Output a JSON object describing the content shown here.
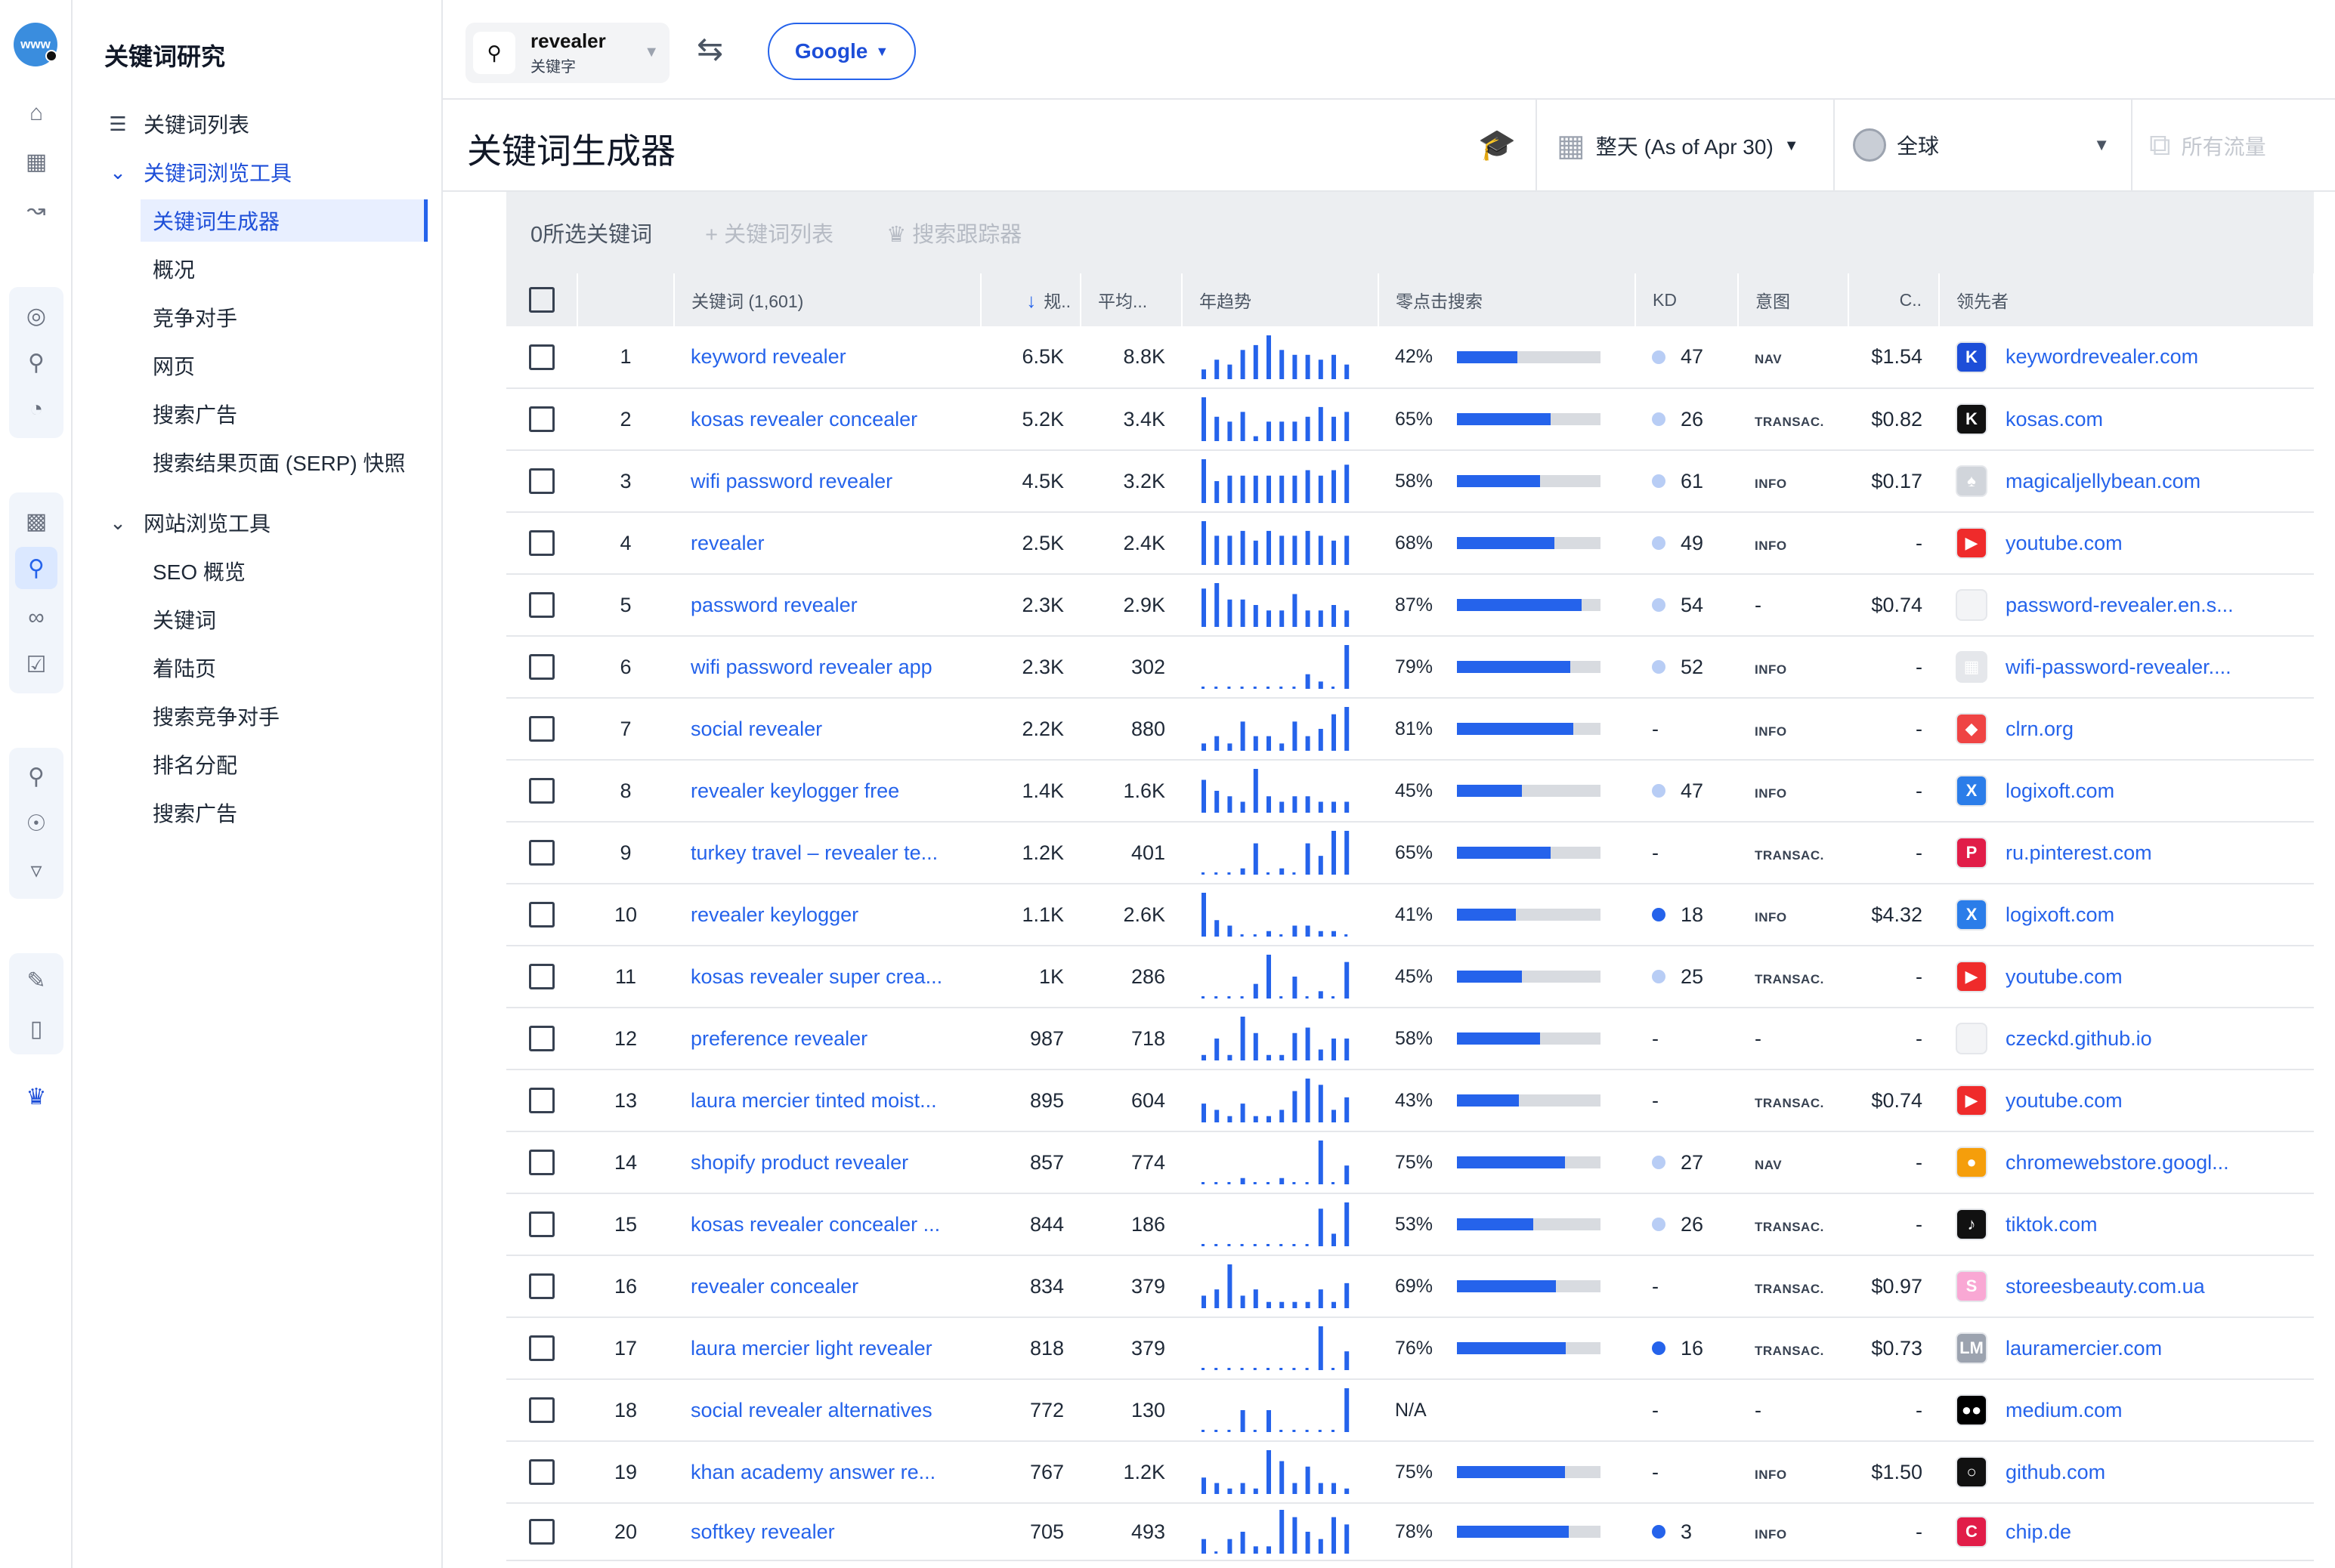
{
  "app": {
    "logo_text": "www",
    "section_title": "关键词研究"
  },
  "sidebar": {
    "items": [
      {
        "label": "关键词列表",
        "level": 1,
        "icon": "list-icon"
      },
      {
        "label": "关键词浏览工具",
        "level": 1,
        "icon": "chevron-down-icon",
        "expanded": true,
        "blue": true
      },
      {
        "label": "关键词生成器",
        "level": 2,
        "selected": true
      },
      {
        "label": "概况",
        "level": 2
      },
      {
        "label": "竞争对手",
        "level": 2
      },
      {
        "label": "网页",
        "level": 2
      },
      {
        "label": "搜索广告",
        "level": 2
      },
      {
        "label": "搜索结果页面 (SERP) 快照",
        "level": 2
      },
      {
        "label": "网站浏览工具",
        "level": 1,
        "icon": "chevron-down-icon",
        "expanded": true
      },
      {
        "label": "SEO 概览",
        "level": 2
      },
      {
        "label": "关键词",
        "level": 2
      },
      {
        "label": "着陆页",
        "level": 2
      },
      {
        "label": "搜索竞争对手",
        "level": 2
      },
      {
        "label": "排名分配",
        "level": 2
      },
      {
        "label": "搜索广告",
        "level": 2
      }
    ]
  },
  "topbar": {
    "search_value": "revealer",
    "search_type": "关键字",
    "engine": "Google"
  },
  "header": {
    "title": "关键词生成器",
    "date": "整天 (As of Apr 30)",
    "geo": "全球",
    "traffic": "所有流量"
  },
  "actions": {
    "selected_count": "0所选关键词",
    "add_list": "+ 关键词列表",
    "tracker": "搜索跟踪器"
  },
  "table": {
    "headers": {
      "keyword": "关键词 (1,601)",
      "volume": "规..",
      "avg": "平均...",
      "trend": "年趋势",
      "zero_click": "零点击搜索",
      "kd": "KD",
      "intent": "意图",
      "cpc": "C..",
      "leader": "领先者"
    },
    "rows": [
      {
        "n": "1",
        "kw": "keyword revealer",
        "vol": "6.5K",
        "avg": "8.8K",
        "zc": "42%",
        "zcv": 42,
        "kd": "47",
        "kdHi": false,
        "intent": "NAV",
        "cpc": "$1.54",
        "leader": "keywordrevealer.com",
        "fav": "K",
        "favBg": "#1d4ed8",
        "trend": [
          2,
          4,
          3,
          6,
          7,
          9,
          6,
          5,
          5,
          4,
          5,
          3
        ]
      },
      {
        "n": "2",
        "kw": "kosas revealer concealer",
        "vol": "5.2K",
        "avg": "3.4K",
        "zc": "65%",
        "zcv": 65,
        "kd": "26",
        "kdHi": false,
        "intent": "TRANSAC.",
        "cpc": "$0.82",
        "leader": "kosas.com",
        "fav": "K",
        "favBg": "#111111",
        "trend": [
          9,
          5,
          4,
          6,
          1,
          4,
          4,
          4,
          5,
          7,
          5,
          6
        ]
      },
      {
        "n": "3",
        "kw": "wifi password revealer",
        "vol": "4.5K",
        "avg": "3.2K",
        "zc": "58%",
        "zcv": 58,
        "kd": "61",
        "kdHi": false,
        "intent": "INFO",
        "cpc": "$0.17",
        "leader": "magicaljellybean.com",
        "fav": "♠",
        "favBg": "#d1d5db",
        "trend": [
          8,
          4,
          5,
          5,
          5,
          5,
          5,
          5,
          6,
          5,
          6,
          7
        ]
      },
      {
        "n": "4",
        "kw": "revealer",
        "vol": "2.5K",
        "avg": "2.4K",
        "zc": "68%",
        "zcv": 68,
        "kd": "49",
        "kdHi": false,
        "intent": "INFO",
        "cpc": "-",
        "leader": "youtube.com",
        "fav": "▶",
        "favBg": "#ef2b2b",
        "trend": [
          9,
          6,
          6,
          7,
          5,
          7,
          6,
          6,
          7,
          6,
          5,
          6
        ]
      },
      {
        "n": "5",
        "kw": "password revealer",
        "vol": "2.3K",
        "avg": "2.9K",
        "zc": "87%",
        "zcv": 87,
        "kd": "54",
        "kdHi": false,
        "intent": "-",
        "cpc": "$0.74",
        "leader": "password-revealer.en.s...",
        "fav": "",
        "favBg": "#f3f4f6",
        "trend": [
          7,
          8,
          5,
          5,
          4,
          3,
          3,
          6,
          3,
          3,
          4,
          3
        ]
      },
      {
        "n": "6",
        "kw": "wifi password revealer app",
        "vol": "2.3K",
        "avg": "302",
        "zc": "79%",
        "zcv": 79,
        "kd": "52",
        "kdHi": false,
        "intent": "INFO",
        "cpc": "-",
        "leader": "wifi-password-revealer....",
        "fav": "▦",
        "favBg": "#e5e7eb",
        "trend": [
          0,
          0,
          0,
          0,
          0,
          0,
          0,
          0,
          2,
          1,
          0,
          6
        ]
      },
      {
        "n": "7",
        "kw": "social revealer",
        "vol": "2.2K",
        "avg": "880",
        "zc": "81%",
        "zcv": 81,
        "kd": "-",
        "kdHi": false,
        "intent": "INFO",
        "cpc": "-",
        "leader": "clrn.org",
        "fav": "◆",
        "favBg": "#ef4444",
        "trend": [
          1,
          2,
          1,
          4,
          2,
          2,
          1,
          4,
          2,
          3,
          5,
          6
        ]
      },
      {
        "n": "8",
        "kw": "revealer keylogger free",
        "vol": "1.4K",
        "avg": "1.6K",
        "zc": "45%",
        "zcv": 45,
        "kd": "47",
        "kdHi": false,
        "intent": "INFO",
        "cpc": "-",
        "leader": "logixoft.com",
        "fav": "X",
        "favBg": "#2b7de9",
        "trend": [
          6,
          4,
          3,
          2,
          8,
          3,
          2,
          3,
          3,
          2,
          2,
          2
        ]
      },
      {
        "n": "9",
        "kw": "turkey travel – revealer te...",
        "vol": "1.2K",
        "avg": "401",
        "zc": "65%",
        "zcv": 65,
        "kd": "-",
        "kdHi": false,
        "intent": "TRANSAC.",
        "cpc": "-",
        "leader": "ru.pinterest.com",
        "fav": "P",
        "favBg": "#e11d48",
        "trend": [
          0,
          0,
          0,
          1,
          5,
          0,
          1,
          0,
          5,
          3,
          7,
          7
        ]
      },
      {
        "n": "10",
        "kw": "revealer keylogger",
        "vol": "1.1K",
        "avg": "2.6K",
        "zc": "41%",
        "zcv": 41,
        "kd": "18",
        "kdHi": true,
        "intent": "INFO",
        "cpc": "$4.32",
        "leader": "logixoft.com",
        "fav": "X",
        "favBg": "#2b7de9",
        "trend": [
          8,
          3,
          2,
          0,
          0,
          1,
          0,
          2,
          2,
          1,
          1,
          0
        ]
      },
      {
        "n": "11",
        "kw": "kosas revealer super crea...",
        "vol": "1K",
        "avg": "286",
        "zc": "45%",
        "zcv": 45,
        "kd": "25",
        "kdHi": false,
        "intent": "TRANSAC.",
        "cpc": "-",
        "leader": "youtube.com",
        "fav": "▶",
        "favBg": "#ef2b2b",
        "trend": [
          0,
          0,
          0,
          0,
          2,
          6,
          0,
          3,
          0,
          1,
          0,
          5
        ]
      },
      {
        "n": "12",
        "kw": "preference revealer",
        "vol": "987",
        "avg": "718",
        "zc": "58%",
        "zcv": 58,
        "kd": "-",
        "kdHi": false,
        "intent": "-",
        "cpc": "-",
        "leader": "czeckd.github.io",
        "fav": "",
        "favBg": "#f3f4f6",
        "trend": [
          1,
          4,
          1,
          8,
          5,
          1,
          1,
          5,
          6,
          2,
          4,
          4
        ]
      },
      {
        "n": "13",
        "kw": "laura mercier tinted moist...",
        "vol": "895",
        "avg": "604",
        "zc": "43%",
        "zcv": 43,
        "kd": "-",
        "kdHi": false,
        "intent": "TRANSAC.",
        "cpc": "$0.74",
        "leader": "youtube.com",
        "fav": "▶",
        "favBg": "#ef2b2b",
        "trend": [
          3,
          2,
          1,
          3,
          1,
          1,
          2,
          5,
          7,
          6,
          2,
          4
        ]
      },
      {
        "n": "14",
        "kw": "shopify product revealer",
        "vol": "857",
        "avg": "774",
        "zc": "75%",
        "zcv": 75,
        "kd": "27",
        "kdHi": false,
        "intent": "NAV",
        "cpc": "-",
        "leader": "chromewebstore.googl...",
        "fav": "●",
        "favBg": "#f59e0b",
        "trend": [
          0,
          0,
          0,
          1,
          0,
          0,
          1,
          0,
          0,
          7,
          0,
          3
        ]
      },
      {
        "n": "15",
        "kw": "kosas revealer concealer ...",
        "vol": "844",
        "avg": "186",
        "zc": "53%",
        "zcv": 53,
        "kd": "26",
        "kdHi": false,
        "intent": "TRANSAC.",
        "cpc": "-",
        "leader": "tiktok.com",
        "fav": "♪",
        "favBg": "#111111",
        "trend": [
          0,
          0,
          0,
          0,
          0,
          0,
          0,
          0,
          0,
          6,
          2,
          7
        ]
      },
      {
        "n": "16",
        "kw": "revealer concealer",
        "vol": "834",
        "avg": "379",
        "zc": "69%",
        "zcv": 69,
        "kd": "-",
        "kdHi": false,
        "intent": "TRANSAC.",
        "cpc": "$0.97",
        "leader": "storeesbeauty.com.ua",
        "fav": "S",
        "favBg": "#f9a8d4",
        "trend": [
          2,
          3,
          7,
          2,
          3,
          1,
          1,
          1,
          1,
          3,
          1,
          4
        ]
      },
      {
        "n": "17",
        "kw": "laura mercier light revealer",
        "vol": "818",
        "avg": "379",
        "zc": "76%",
        "zcv": 76,
        "kd": "16",
        "kdHi": true,
        "intent": "TRANSAC.",
        "cpc": "$0.73",
        "leader": "lauramercier.com",
        "fav": "LM",
        "favBg": "#9ca3af",
        "trend": [
          0,
          0,
          0,
          0,
          0,
          0,
          0,
          0,
          0,
          7,
          0,
          3
        ]
      },
      {
        "n": "18",
        "kw": "social revealer alternatives",
        "vol": "772",
        "avg": "130",
        "zc": "N/A",
        "zcv": 0,
        "kd": "-",
        "kdHi": false,
        "intent": "-",
        "cpc": "-",
        "leader": "medium.com",
        "fav": "●●",
        "favBg": "#000000",
        "trend": [
          0,
          0,
          0,
          4,
          0,
          4,
          0,
          0,
          0,
          0,
          0,
          8
        ]
      },
      {
        "n": "19",
        "kw": "khan academy answer re...",
        "vol": "767",
        "avg": "1.2K",
        "zc": "75%",
        "zcv": 75,
        "kd": "-",
        "kdHi": false,
        "intent": "INFO",
        "cpc": "$1.50",
        "leader": "github.com",
        "fav": "○",
        "favBg": "#111111",
        "trend": [
          3,
          2,
          1,
          2,
          1,
          8,
          6,
          2,
          5,
          2,
          2,
          1
        ]
      },
      {
        "n": "20",
        "kw": "softkey revealer",
        "vol": "705",
        "avg": "493",
        "zc": "78%",
        "zcv": 78,
        "kd": "3",
        "kdHi": true,
        "intent": "INFO",
        "cpc": "-",
        "leader": "chip.de",
        "fav": "C",
        "favBg": "#e11d48",
        "trend": [
          2,
          0,
          2,
          3,
          1,
          1,
          6,
          5,
          3,
          2,
          5,
          4
        ]
      }
    ]
  },
  "colors": {
    "accent": "#2563eb",
    "bar_track": "#d8dbe0",
    "header_bg": "#eceef1"
  },
  "icons": {
    "rail": [
      "home-icon",
      "dashboard-icon",
      "chart-line-icon",
      "globe-icon",
      "globe-search-icon",
      "pie-icon",
      "bar-chart-icon",
      "keyword-research-icon",
      "link-icon",
      "checklist-icon",
      "search-zoom-icon",
      "search-target-icon",
      "filter-icon",
      "report-icon",
      "mobile-icon",
      "crown-icon"
    ]
  }
}
